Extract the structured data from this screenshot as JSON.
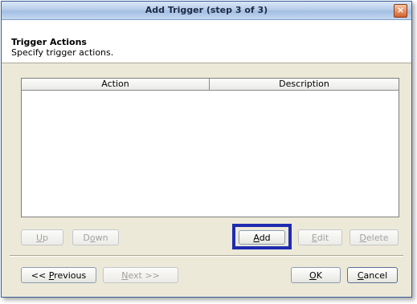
{
  "window": {
    "title": "Add Trigger (step 3 of 3)",
    "close_glyph": "×"
  },
  "header": {
    "title": "Trigger Actions",
    "subtitle": "Specify trigger actions."
  },
  "table": {
    "columns": [
      "Action",
      "Description"
    ],
    "rows": []
  },
  "table_buttons": {
    "up": {
      "label_mnemonic": "U",
      "label_rest": "p",
      "enabled": false
    },
    "down": {
      "label_pre": "D",
      "label_mnemonic": "o",
      "label_rest": "wn",
      "enabled": false
    },
    "add": {
      "label_mnemonic": "A",
      "label_rest": "dd",
      "enabled": true
    },
    "edit": {
      "label_mnemonic": "E",
      "label_rest": "dit",
      "enabled": false
    },
    "delete": {
      "label_mnemonic": "D",
      "label_rest": "elete",
      "enabled": false
    }
  },
  "footer_buttons": {
    "previous": {
      "label_pre": "<< ",
      "label_mnemonic": "P",
      "label_rest": "revious",
      "enabled": true
    },
    "next": {
      "label_mnemonic": "N",
      "label_rest": "ext >>",
      "enabled": false
    },
    "ok": {
      "label_mnemonic": "O",
      "label_rest": "K",
      "enabled": true
    },
    "cancel": {
      "label_mnemonic": "C",
      "label_rest": "ancel",
      "enabled": true
    }
  },
  "colors": {
    "highlight": "#1f2bb0",
    "dialog_bg": "#ece9d8",
    "title_text": "#1d2b44"
  }
}
